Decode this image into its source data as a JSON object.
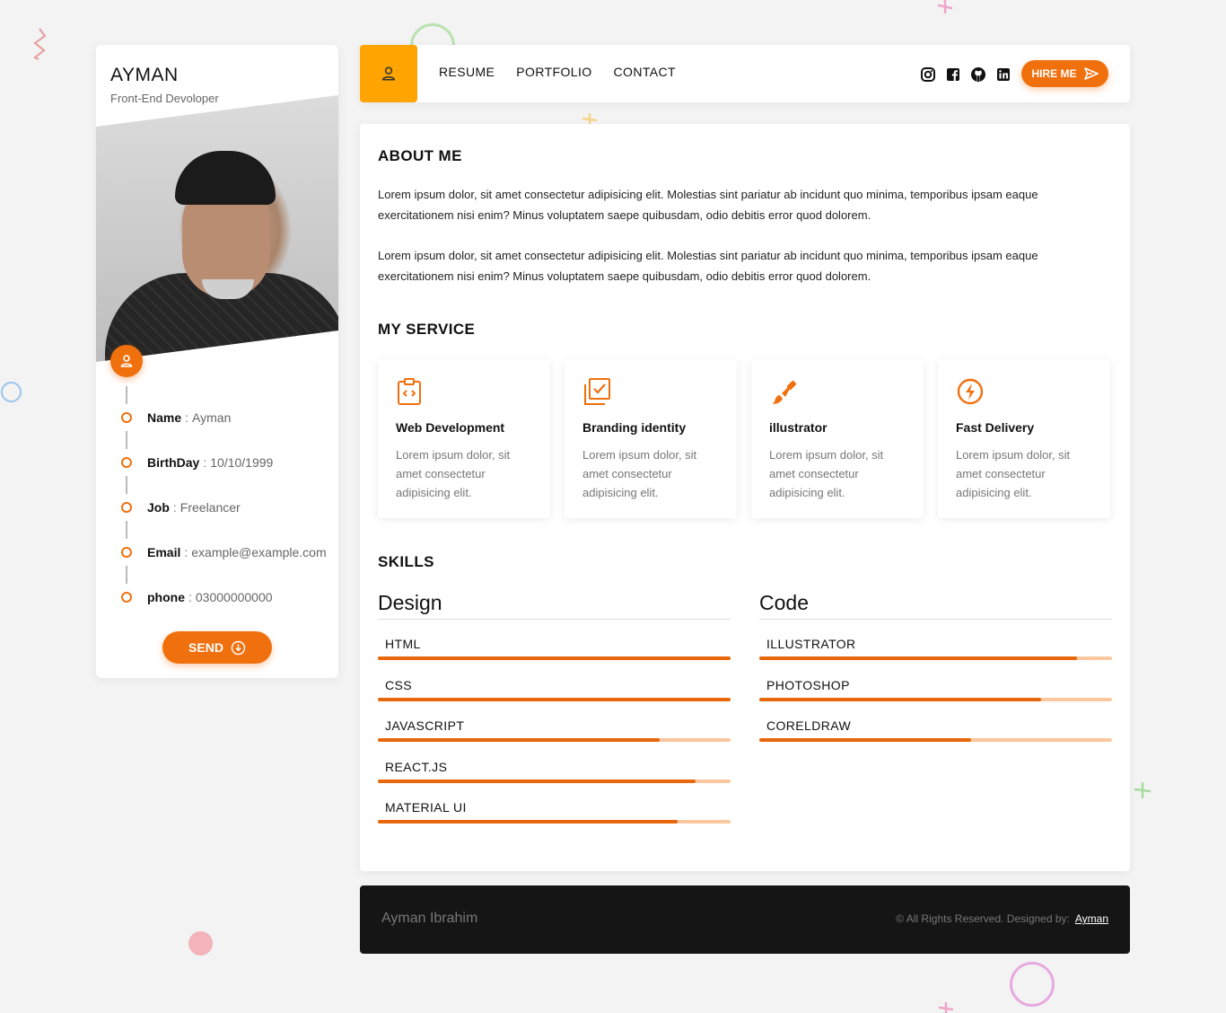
{
  "profile": {
    "name": "AYMAN",
    "role": "Front-End Devoloper",
    "info": [
      {
        "label": "Name",
        "value": "Ayman"
      },
      {
        "label": "BirthDay",
        "value": "10/10/1999"
      },
      {
        "label": "Job",
        "value": "Freelancer"
      },
      {
        "label": "Email",
        "value": "example@example.com"
      },
      {
        "label": "phone",
        "value": "03000000000"
      }
    ],
    "send_label": "SEND"
  },
  "nav": {
    "links": [
      "RESUME",
      "PORTFOLIO",
      "CONTACT"
    ],
    "social_icons": [
      "instagram-icon",
      "facebook-icon",
      "github-icon",
      "linkedin-icon"
    ],
    "hire_label": "HIRE ME"
  },
  "about": {
    "title": "ABOUT ME",
    "paragraphs": [
      "Lorem ipsum dolor, sit amet consectetur adipisicing elit. Molestias sint pariatur ab incidunt quo minima, temporibus ipsam eaque exercitationem nisi enim? Minus voluptatem saepe quibusdam, odio debitis error quod dolorem.",
      "Lorem ipsum dolor, sit amet consectetur adipisicing elit. Molestias sint pariatur ab incidunt quo minima, temporibus ipsam eaque exercitationem nisi enim? Minus voluptatem saepe quibusdam, odio debitis error quod dolorem."
    ]
  },
  "services": {
    "title": "MY SERVICE",
    "items": [
      {
        "icon": "code-icon",
        "title": "Web Development",
        "desc": "Lorem ipsum dolor, sit amet consectetur adipisicing elit."
      },
      {
        "icon": "checklist-icon",
        "title": "Branding identity",
        "desc": "Lorem ipsum dolor, sit amet consectetur adipisicing elit."
      },
      {
        "icon": "brush-icon",
        "title": "illustrator",
        "desc": "Lorem ipsum dolor, sit amet consectetur adipisicing elit."
      },
      {
        "icon": "lightning-icon",
        "title": "Fast Delivery",
        "desc": "Lorem ipsum dolor, sit amet consectetur adipisicing elit."
      }
    ]
  },
  "skills": {
    "title": "SKILLS",
    "columns": [
      {
        "title": "Design",
        "items": [
          {
            "name": "HTML",
            "level": 100
          },
          {
            "name": "CSS",
            "level": 100
          },
          {
            "name": "JAVASCRIPT",
            "level": 80
          },
          {
            "name": "REACT.JS",
            "level": 90
          },
          {
            "name": "MATERIAL UI",
            "level": 85
          }
        ]
      },
      {
        "title": "Code",
        "items": [
          {
            "name": "ILLUSTRATOR",
            "level": 90
          },
          {
            "name": "PHOTOSHOP",
            "level": 80
          },
          {
            "name": "CORELDRAW",
            "level": 60
          }
        ]
      }
    ]
  },
  "footer": {
    "brand": "Ayman Ibrahim",
    "rights": "© All Rights Reserved. Designed by:",
    "designer": "Ayman"
  },
  "colors": {
    "accent": "#f0700e",
    "home_tile": "#ffa400",
    "track": "#fbc79e",
    "footer_bg": "#151515"
  }
}
